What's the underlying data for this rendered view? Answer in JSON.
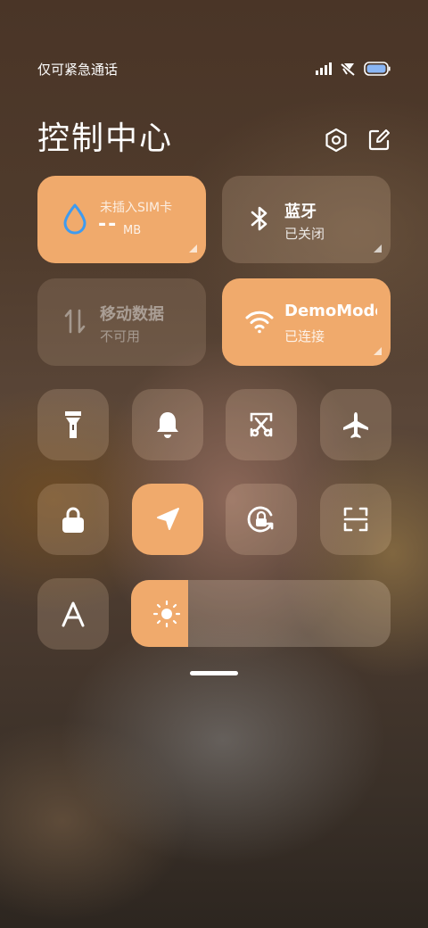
{
  "status": {
    "carrier_text": "仅可紧急通话",
    "battery_color": "#8ab6f5"
  },
  "header": {
    "title": "控制中心",
    "settings_icon": "hexagon-settings-icon",
    "edit_icon": "edit-icon"
  },
  "tiles": {
    "data_usage": {
      "label": "未插入SIM卡",
      "value": "--",
      "unit": "MB",
      "icon": "drop-icon"
    },
    "bluetooth": {
      "label": "蓝牙",
      "status": "已关闭",
      "icon": "bluetooth-icon"
    },
    "mobile_data": {
      "label": "移动数据",
      "status": "不可用",
      "icon": "data-arrows-icon"
    },
    "wifi": {
      "label": "DemoMode",
      "status": "已连接",
      "icon": "wifi-icon"
    }
  },
  "toggles": {
    "row1": [
      "flashlight-icon",
      "bell-icon",
      "screenshot-icon",
      "airplane-icon"
    ],
    "row2": [
      "lock-icon",
      "location-icon",
      "rotation-lock-icon",
      "scan-icon"
    ]
  },
  "brightness": {
    "level": 0.22,
    "icon": "sun-icon"
  },
  "font_size_icon": "font-a-icon",
  "colors": {
    "accent": "#f0aa6c"
  }
}
